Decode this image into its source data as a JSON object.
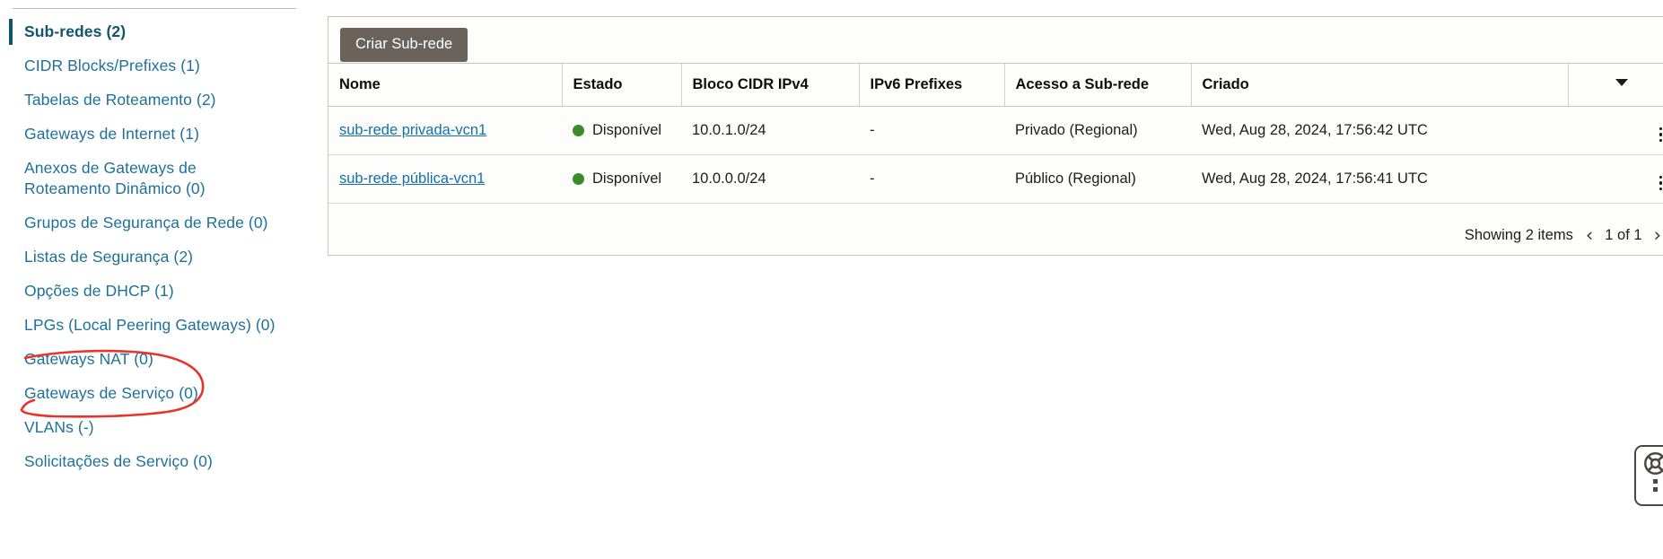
{
  "sidebar": {
    "items": [
      {
        "label": "Sub-redes (2)",
        "active": true
      },
      {
        "label": "CIDR Blocks/Prefixes (1)",
        "active": false
      },
      {
        "label": "Tabelas de Roteamento (2)",
        "active": false
      },
      {
        "label": "Gateways de Internet (1)",
        "active": false
      },
      {
        "label": "Anexos de Gateways de\nRoteamento Dinâmico (0)",
        "active": false
      },
      {
        "label": "Grupos de Segurança de Rede (0)",
        "active": false
      },
      {
        "label": "Listas de Segurança (2)",
        "active": false
      },
      {
        "label": "Opções de DHCP (1)",
        "active": false
      },
      {
        "label": "LPGs (Local Peering Gateways) (0)",
        "active": false
      },
      {
        "label": "Gateways NAT (0)",
        "active": false
      },
      {
        "label": "Gateways de Serviço (0)",
        "active": false
      },
      {
        "label": "VLANs (-)",
        "active": false
      },
      {
        "label": "Solicitações de Serviço (0)",
        "active": false
      }
    ]
  },
  "toolbar": {
    "create_label": "Criar Sub-rede"
  },
  "table": {
    "columns": [
      "Nome",
      "Estado",
      "Bloco CIDR IPv4",
      "IPv6 Prefixes",
      "Acesso a Sub-rede",
      "Criado"
    ],
    "rows": [
      {
        "nome": "sub-rede privada-vcn1",
        "estado": "Disponível",
        "cidr": "10.0.1.0/24",
        "ipv6": "-",
        "acesso": "Privado (Regional)",
        "criado": "Wed, Aug 28, 2024, 17:56:42 UTC"
      },
      {
        "nome": "sub-rede pública-vcn1",
        "estado": "Disponível",
        "cidr": "10.0.0.0/24",
        "ipv6": "-",
        "acesso": "Público (Regional)",
        "criado": "Wed, Aug 28, 2024, 17:56:41 UTC"
      }
    ]
  },
  "footer": {
    "showing": "Showing 2 items",
    "prev": "‹",
    "page": "1 of 1",
    "next": "›"
  },
  "colors": {
    "link": "#1f7099",
    "active_item": "#10556e",
    "button_bg": "#6b625c",
    "status_dot": "#3b8c29",
    "annotation": "#e8332a"
  }
}
